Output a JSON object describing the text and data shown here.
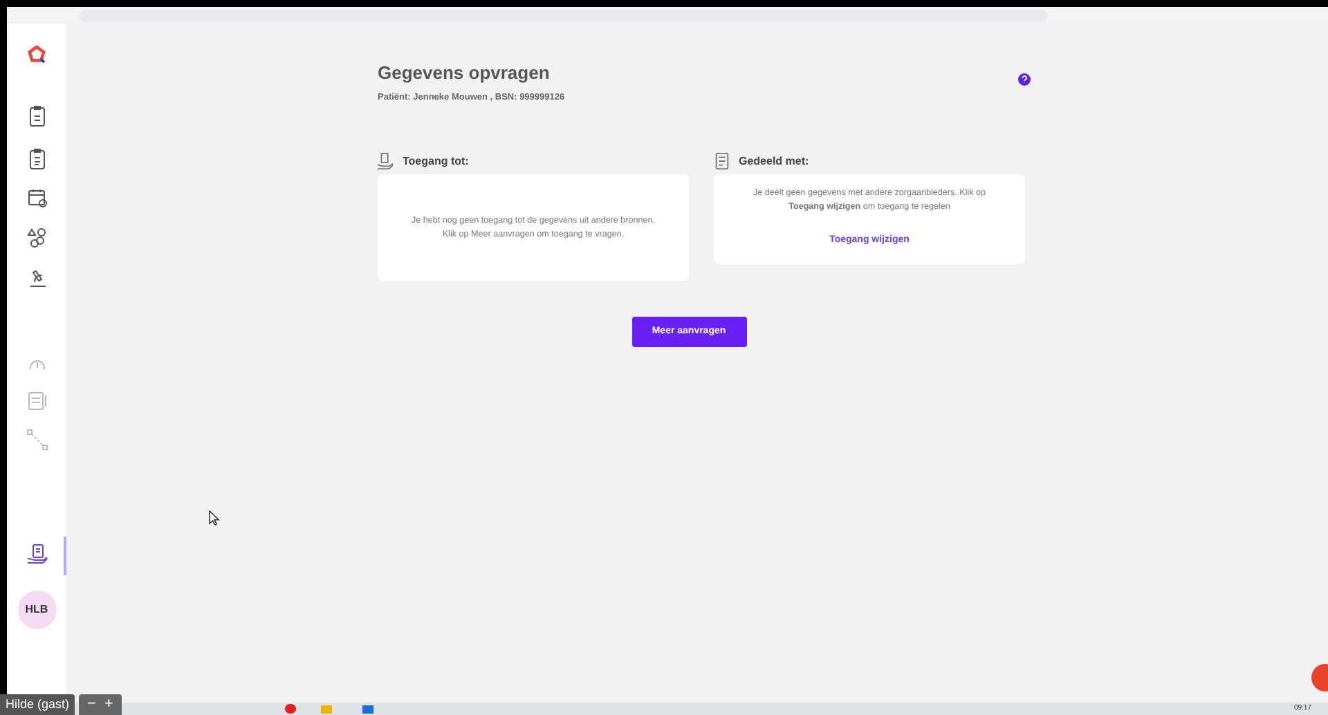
{
  "sidebar": {
    "items": [
      {
        "selected": false,
        "disabled": false
      },
      {
        "selected": false,
        "disabled": false
      },
      {
        "selected": false,
        "disabled": false
      },
      {
        "selected": false,
        "disabled": false
      },
      {
        "selected": false,
        "disabled": false
      },
      {
        "selected": false,
        "disabled": true
      },
      {
        "selected": false,
        "disabled": true
      },
      {
        "selected": false,
        "disabled": true
      },
      {
        "selected": true,
        "disabled": false
      }
    ],
    "user_initials": "HLB"
  },
  "page": {
    "title": "Gegevens opvragen",
    "patient": "Patiënt: Jenneke Mouwen , BSN: 999999126"
  },
  "panels": [
    {
      "heading": "Toegang tot:",
      "body": "Je hebt nog geen toegang tot de gegevens uit andere bronnen. Klik op Meer aanvragen om toegang te vragen."
    },
    {
      "heading": "Gedeeld met:",
      "body": "Je deelt geen gegevens met andere zorgaanbieders. Klik op **Toegang wijzigen** om toegang te regelen",
      "link": "Toegang wijzigen"
    }
  ],
  "primary_button": "Meer aanvragen",
  "call_overlay": {
    "participant": "Hilde (gast)",
    "zoom_out": "−",
    "zoom_in": "+"
  },
  "taskbar": {
    "clock": "09:17"
  }
}
